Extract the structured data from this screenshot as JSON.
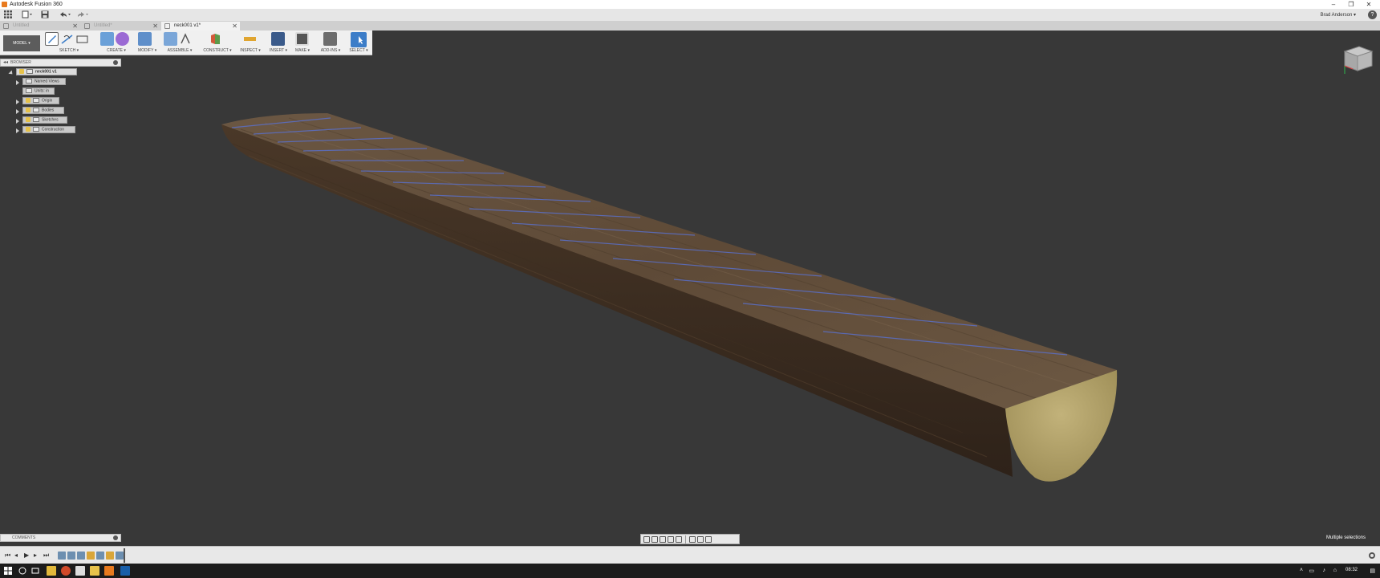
{
  "window": {
    "title": "Autodesk Fusion 360"
  },
  "quick_access": {
    "user_name": "Brad Anderson",
    "user_chevron": "▾",
    "help_icon": "?"
  },
  "tabs": [
    {
      "label": "Untitled",
      "active": false
    },
    {
      "label": "Untitled*",
      "active": false
    },
    {
      "label": "neck001 v1*",
      "active": true
    }
  ],
  "toolbar": {
    "workspace": "MODEL",
    "groups": [
      {
        "label": "SKETCH ▾"
      },
      {
        "label": "CREATE ▾"
      },
      {
        "label": "MODIFY ▾"
      },
      {
        "label": "ASSEMBLE ▾"
      },
      {
        "label": "CONSTRUCT ▾"
      },
      {
        "label": "INSPECT ▾"
      },
      {
        "label": "INSERT ▾"
      },
      {
        "label": "MAKE ▾"
      },
      {
        "label": "ADD-INS ▾"
      },
      {
        "label": "SELECT ▾"
      }
    ]
  },
  "browser": {
    "title": "BROWSER",
    "root": "neck001 v1",
    "items": [
      {
        "label": "Named Views"
      },
      {
        "label": "Units: in"
      },
      {
        "label": "Origin"
      },
      {
        "label": "Bodies"
      },
      {
        "label": "Sketches"
      },
      {
        "label": "Construction"
      }
    ]
  },
  "comments": {
    "title": "COMMENTS"
  },
  "status": {
    "text": "Multiple selections"
  },
  "taskbar": {
    "clock": "08:32"
  },
  "colors": {
    "viewport_bg": "#383838",
    "wood": "#5a4733",
    "cut_face": "#b4a46a",
    "fret_line": "#5a6fc8",
    "accent_blue": "#3c7dc8"
  }
}
